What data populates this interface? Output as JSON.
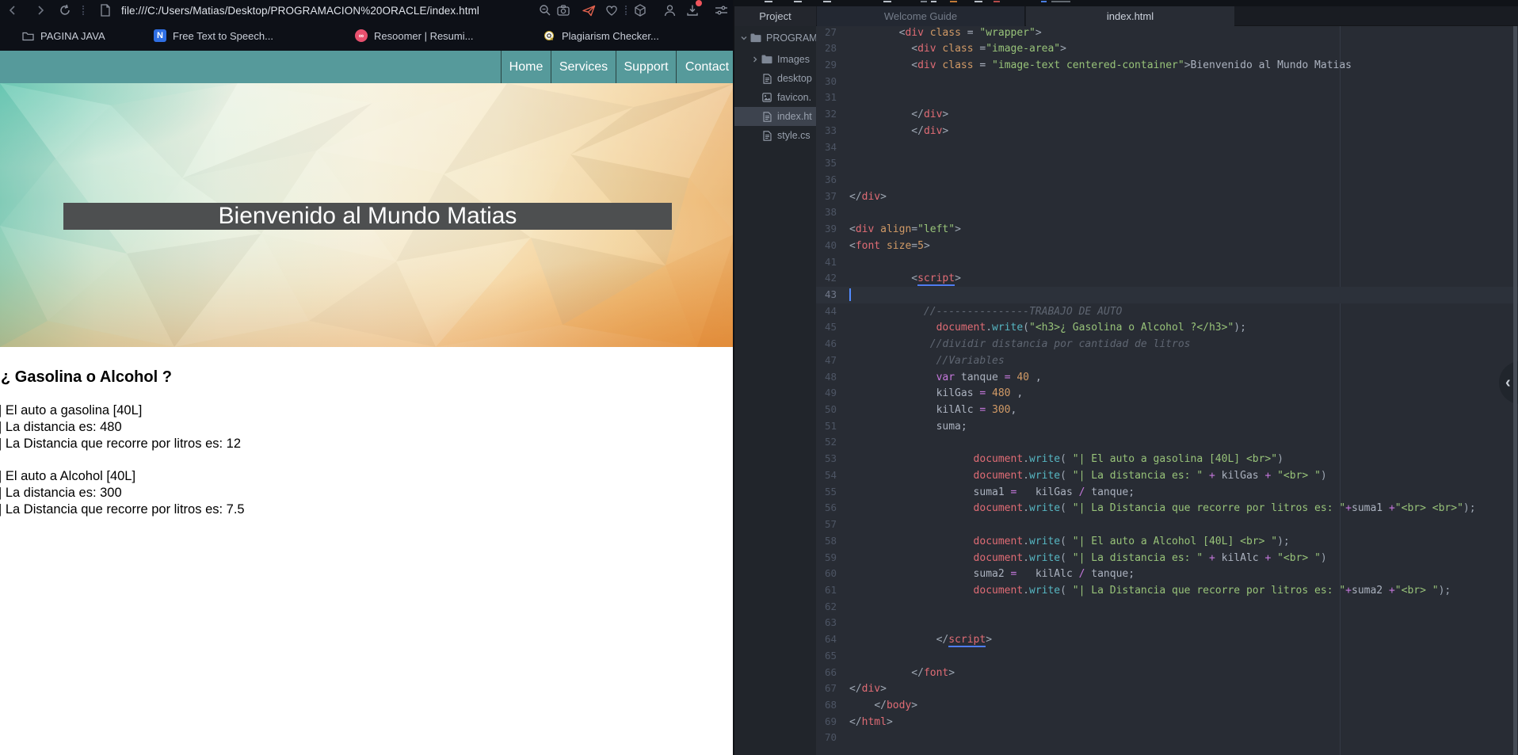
{
  "browser": {
    "url": "file:///C:/Users/Matias/Desktop/PROGRAMACION%20ORACLE/index.html",
    "bookmarks": [
      {
        "label": "PAGINA JAVA",
        "icon": "folder"
      },
      {
        "label": "Free Text to Speech...",
        "icon": "naturalreader-n"
      },
      {
        "label": "Resoomer | Resumi...",
        "icon": "resoomer-circle"
      },
      {
        "label": "Plagiarism Checker...",
        "icon": "magnifier-q"
      }
    ]
  },
  "page": {
    "nav": [
      "Home",
      "Services",
      "Support",
      "Contact"
    ],
    "hero_title": "Bienvenido al Mundo Matias",
    "heading": "¿ Gasolina o Alcohol ?",
    "lines": [
      "| El auto a gasolina [40L]",
      "| La distancia es: 480",
      "| La Distancia que recorre por litros es: 12",
      "",
      "| El auto a Alcohol [40L]",
      "| La distancia es: 300",
      "| La Distancia que recorre por litros es: 7.5"
    ]
  },
  "ide": {
    "project_tab": "Project",
    "tabs": [
      "Welcome Guide",
      "index.html"
    ],
    "tree": [
      {
        "label": "PROGRAM",
        "icon": "folder",
        "chevron": "down",
        "level": 0,
        "selected": false
      },
      {
        "label": "Images",
        "icon": "folder",
        "chevron": "right",
        "level": 1,
        "selected": false
      },
      {
        "label": "desktop",
        "icon": "file",
        "chevron": "none",
        "level": 1,
        "selected": false
      },
      {
        "label": "favicon.",
        "icon": "image",
        "chevron": "none",
        "level": 1,
        "selected": false
      },
      {
        "label": "index.ht",
        "icon": "file",
        "chevron": "none",
        "level": 1,
        "selected": true
      },
      {
        "label": "style.cs",
        "icon": "file",
        "chevron": "none",
        "level": 1,
        "selected": false
      }
    ],
    "editor": {
      "current_line": 43,
      "lines": [
        [
          27,
          [
            [
              "ws",
              "        "
            ],
            [
              "pun",
              "<"
            ],
            [
              "tag",
              "div"
            ],
            [
              "pl",
              " "
            ],
            [
              "attr",
              "class"
            ],
            [
              "pl",
              " = "
            ],
            [
              "str",
              "\"wrapper\""
            ],
            [
              "pun",
              ">"
            ]
          ]
        ],
        [
          28,
          [
            [
              "ws",
              "          "
            ],
            [
              "pun",
              "<"
            ],
            [
              "tag",
              "div"
            ],
            [
              "pl",
              " "
            ],
            [
              "attr",
              "class"
            ],
            [
              "pl",
              " ="
            ],
            [
              "str",
              "\"image-area\""
            ],
            [
              "pun",
              ">"
            ]
          ]
        ],
        [
          29,
          [
            [
              "ws",
              "          "
            ],
            [
              "pun",
              "<"
            ],
            [
              "tag",
              "div"
            ],
            [
              "pl",
              " "
            ],
            [
              "attr",
              "class"
            ],
            [
              "pl",
              " = "
            ],
            [
              "str",
              "\"image-text centered-container\""
            ],
            [
              "pun",
              ">"
            ],
            [
              "pl",
              "Bienvenido al Mundo Matias"
            ]
          ]
        ],
        [
          30,
          []
        ],
        [
          31,
          []
        ],
        [
          32,
          [
            [
              "ws",
              "          "
            ],
            [
              "pun",
              "</"
            ],
            [
              "tag",
              "div"
            ],
            [
              "pun",
              ">"
            ]
          ]
        ],
        [
          33,
          [
            [
              "ws",
              "          "
            ],
            [
              "pun",
              "</"
            ],
            [
              "tag",
              "div"
            ],
            [
              "pun",
              ">"
            ]
          ]
        ],
        [
          34,
          []
        ],
        [
          35,
          []
        ],
        [
          36,
          []
        ],
        [
          37,
          [
            [
              "pun",
              "</"
            ],
            [
              "tag",
              "div"
            ],
            [
              "pun",
              ">"
            ]
          ]
        ],
        [
          38,
          []
        ],
        [
          39,
          [
            [
              "pun",
              "<"
            ],
            [
              "tag",
              "div"
            ],
            [
              "pl",
              " "
            ],
            [
              "attr",
              "align"
            ],
            [
              "pun",
              "="
            ],
            [
              "str",
              "\"left\""
            ],
            [
              "pun",
              ">"
            ]
          ]
        ],
        [
          40,
          [
            [
              "pun",
              "<"
            ],
            [
              "tag",
              "font"
            ],
            [
              "pl",
              " "
            ],
            [
              "attr",
              "size"
            ],
            [
              "pun",
              "="
            ],
            [
              "num",
              "5"
            ],
            [
              "pun",
              ">"
            ]
          ]
        ],
        [
          41,
          []
        ],
        [
          42,
          [
            [
              "ws",
              "          "
            ],
            [
              "pun",
              "<"
            ],
            [
              "tagu",
              "script"
            ],
            [
              "pun",
              ">"
            ]
          ]
        ],
        [
          43,
          []
        ],
        [
          44,
          [
            [
              "ws",
              "            "
            ],
            [
              "cm",
              "//---------------TRABAJO DE AUTO"
            ]
          ]
        ],
        [
          45,
          [
            [
              "ws",
              "              "
            ],
            [
              "obj",
              "document"
            ],
            [
              "pun",
              "."
            ],
            [
              "fn",
              "write"
            ],
            [
              "pun",
              "("
            ],
            [
              "str",
              "\"<h3>¿ Gasolina o Alcohol ?</h3>\""
            ],
            [
              "pun",
              ");"
            ]
          ]
        ],
        [
          46,
          [
            [
              "ws",
              "             "
            ],
            [
              "cm",
              "//dividir distancia por cantidad de litros"
            ]
          ]
        ],
        [
          47,
          [
            [
              "ws",
              "              "
            ],
            [
              "cm",
              "//Variables"
            ]
          ]
        ],
        [
          48,
          [
            [
              "ws",
              "              "
            ],
            [
              "kw",
              "var"
            ],
            [
              "pl",
              " tanque "
            ],
            [
              "op",
              "="
            ],
            [
              "pl",
              " "
            ],
            [
              "num",
              "40"
            ],
            [
              "pl",
              " ,"
            ]
          ]
        ],
        [
          49,
          [
            [
              "ws",
              "              "
            ],
            [
              "pl",
              "kilGas "
            ],
            [
              "op",
              "="
            ],
            [
              "pl",
              " "
            ],
            [
              "num",
              "480"
            ],
            [
              "pl",
              " ,"
            ]
          ]
        ],
        [
          50,
          [
            [
              "ws",
              "              "
            ],
            [
              "pl",
              "kilAlc "
            ],
            [
              "op",
              "="
            ],
            [
              "pl",
              " "
            ],
            [
              "num",
              "300"
            ],
            [
              "pl",
              ","
            ]
          ]
        ],
        [
          51,
          [
            [
              "ws",
              "              "
            ],
            [
              "pl",
              "suma;"
            ]
          ]
        ],
        [
          52,
          []
        ],
        [
          53,
          [
            [
              "ws",
              "                    "
            ],
            [
              "obj",
              "document"
            ],
            [
              "pun",
              "."
            ],
            [
              "fn",
              "write"
            ],
            [
              "pun",
              "( "
            ],
            [
              "str",
              "\"| El auto a gasolina [40L] <br>\""
            ],
            [
              "pun",
              ")"
            ]
          ]
        ],
        [
          54,
          [
            [
              "ws",
              "                    "
            ],
            [
              "obj",
              "document"
            ],
            [
              "pun",
              "."
            ],
            [
              "fn",
              "write"
            ],
            [
              "pun",
              "( "
            ],
            [
              "str",
              "\"| La distancia es: \""
            ],
            [
              "pl",
              " "
            ],
            [
              "op",
              "+"
            ],
            [
              "pl",
              " kilGas "
            ],
            [
              "op",
              "+"
            ],
            [
              "pl",
              " "
            ],
            [
              "str",
              "\"<br> \""
            ],
            [
              "pun",
              ")"
            ]
          ]
        ],
        [
          55,
          [
            [
              "ws",
              "                    "
            ],
            [
              "pl",
              "suma1 "
            ],
            [
              "op",
              "="
            ],
            [
              "pl",
              "   kilGas "
            ],
            [
              "op",
              "/"
            ],
            [
              "pl",
              " tanque;"
            ]
          ]
        ],
        [
          56,
          [
            [
              "ws",
              "                    "
            ],
            [
              "obj",
              "document"
            ],
            [
              "pun",
              "."
            ],
            [
              "fn",
              "write"
            ],
            [
              "pun",
              "( "
            ],
            [
              "str",
              "\"| La Distancia que recorre por litros es: \""
            ],
            [
              "op",
              "+"
            ],
            [
              "pl",
              "suma1 "
            ],
            [
              "op",
              "+"
            ],
            [
              "str",
              "\"<br> <br>\""
            ],
            [
              "pun",
              ");"
            ]
          ]
        ],
        [
          57,
          []
        ],
        [
          58,
          [
            [
              "ws",
              "                    "
            ],
            [
              "obj",
              "document"
            ],
            [
              "pun",
              "."
            ],
            [
              "fn",
              "write"
            ],
            [
              "pun",
              "( "
            ],
            [
              "str",
              "\"| El auto a Alcohol [40L] <br> \""
            ],
            [
              "pun",
              ");"
            ]
          ]
        ],
        [
          59,
          [
            [
              "ws",
              "                    "
            ],
            [
              "obj",
              "document"
            ],
            [
              "pun",
              "."
            ],
            [
              "fn",
              "write"
            ],
            [
              "pun",
              "( "
            ],
            [
              "str",
              "\"| La distancia es: \""
            ],
            [
              "pl",
              " "
            ],
            [
              "op",
              "+"
            ],
            [
              "pl",
              " kilAlc "
            ],
            [
              "op",
              "+"
            ],
            [
              "pl",
              " "
            ],
            [
              "str",
              "\"<br> \""
            ],
            [
              "pun",
              ")"
            ]
          ]
        ],
        [
          60,
          [
            [
              "ws",
              "                    "
            ],
            [
              "pl",
              "suma2 "
            ],
            [
              "op",
              "="
            ],
            [
              "pl",
              "   kilAlc "
            ],
            [
              "op",
              "/"
            ],
            [
              "pl",
              " tanque;"
            ]
          ]
        ],
        [
          61,
          [
            [
              "ws",
              "                    "
            ],
            [
              "obj",
              "document"
            ],
            [
              "pun",
              "."
            ],
            [
              "fn",
              "write"
            ],
            [
              "pun",
              "( "
            ],
            [
              "str",
              "\"| La Distancia que recorre por litros es: \""
            ],
            [
              "op",
              "+"
            ],
            [
              "pl",
              "suma2 "
            ],
            [
              "op",
              "+"
            ],
            [
              "str",
              "\"<br> \""
            ],
            [
              "pun",
              ");"
            ]
          ]
        ],
        [
          62,
          []
        ],
        [
          63,
          []
        ],
        [
          64,
          [
            [
              "ws",
              "              "
            ],
            [
              "pun",
              "</"
            ],
            [
              "tagu",
              "script"
            ],
            [
              "pun",
              ">"
            ]
          ]
        ],
        [
          65,
          []
        ],
        [
          66,
          [
            [
              "ws",
              "          "
            ],
            [
              "pun",
              "</"
            ],
            [
              "tag",
              "font"
            ],
            [
              "pun",
              ">"
            ]
          ]
        ],
        [
          67,
          [
            [
              "pun",
              "</"
            ],
            [
              "tag",
              "div"
            ],
            [
              "pun",
              ">"
            ]
          ]
        ],
        [
          68,
          [
            [
              "ws",
              "    "
            ],
            [
              "pun",
              "</"
            ],
            [
              "tag",
              "body"
            ],
            [
              "pun",
              ">"
            ]
          ]
        ],
        [
          69,
          [
            [
              "pun",
              "</"
            ],
            [
              "tag",
              "html"
            ],
            [
              "pun",
              ">"
            ]
          ]
        ],
        [
          70,
          []
        ]
      ]
    }
  }
}
